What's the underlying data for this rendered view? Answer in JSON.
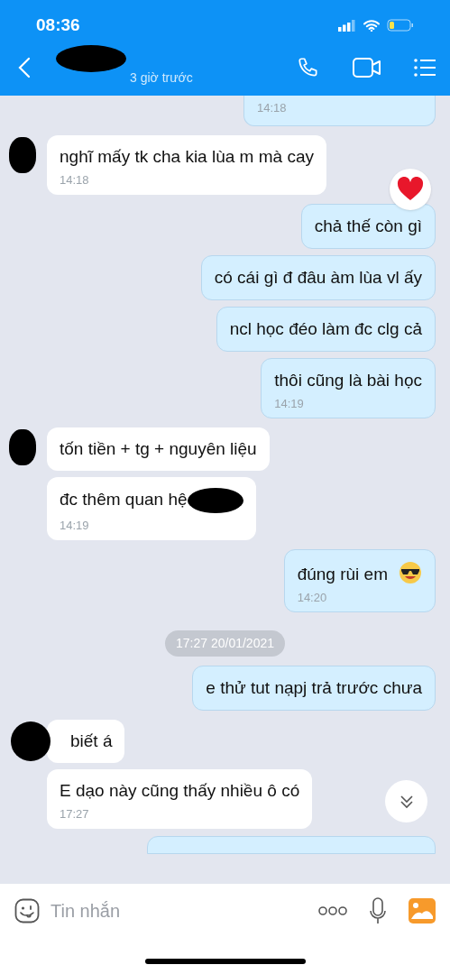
{
  "status_bar": {
    "time": "08:36"
  },
  "header": {
    "name_redacted": true,
    "status": "3 giờ trước"
  },
  "messages": [
    {
      "kind": "outgoing_cut",
      "time": "14:18"
    },
    {
      "kind": "incoming",
      "avatar": true,
      "text": "nghĩ mấy tk cha kia lùa m mà cay",
      "time": "14:18"
    },
    {
      "kind": "outgoing",
      "text": "chả thế còn gì",
      "heart_reaction": true
    },
    {
      "kind": "outgoing",
      "text": "có cái gì đ đâu àm lùa vl ấy"
    },
    {
      "kind": "outgoing",
      "text": "ncl  học đéo làm đc clg cả"
    },
    {
      "kind": "outgoing",
      "text": "thôi  cũng là  bài học",
      "time": "14:19"
    },
    {
      "kind": "incoming",
      "avatar": true,
      "text": "tốn tiền + tg + nguyên liệu"
    },
    {
      "kind": "incoming",
      "text": "đc thêm quan hệ",
      "redacted": true,
      "time": "14:19"
    },
    {
      "kind": "outgoing",
      "text": "đúng rùi em",
      "sunglasses_emoji": true,
      "time": "14:20"
    },
    {
      "kind": "date",
      "text": "17:27 20/01/2021"
    },
    {
      "kind": "outgoing",
      "text": "e thử tut nạpj trả trước chưa"
    },
    {
      "kind": "incoming",
      "avatar": true,
      "redacted": true,
      "text": "biết á"
    },
    {
      "kind": "incoming",
      "text": "E dạo này cũng thấy nhiều ô có",
      "time": "17:27"
    },
    {
      "kind": "outgoing_bottom"
    }
  ],
  "composer": {
    "placeholder": "Tin nhắn"
  }
}
